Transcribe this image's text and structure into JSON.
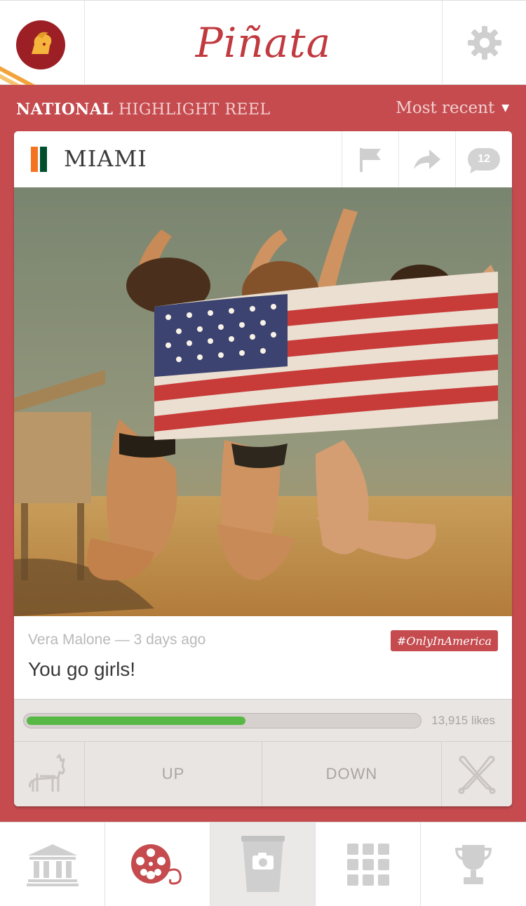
{
  "app": {
    "title": "Piñata",
    "team_logo": "usc-trojan-logo",
    "settings_icon": "gear-icon"
  },
  "reel": {
    "title_bold": "NATIONAL",
    "title_light": "HIGHLIGHT REEL",
    "sort_label": "Most recent",
    "sort_icon": "caret-down-icon"
  },
  "post": {
    "school": "MIAMI",
    "school_colors": [
      "#f47321",
      "#ffffff",
      "#005030"
    ],
    "actions": [
      {
        "icon": "flag-icon"
      },
      {
        "icon": "share-arrow-icon"
      },
      {
        "icon": "comment-bubble-icon",
        "count": "12"
      }
    ],
    "author_line": "Vera Malone — 3 days ago",
    "hashtag": "#OnlyInAmerica",
    "caption": "You go girls!",
    "like_progress": 0.56,
    "likes_label": "13,915 likes",
    "vote": {
      "up_label": "UP",
      "down_label": "DOWN",
      "left_icon": "pinata-donkey-icon",
      "right_icon": "crossed-bats-icon"
    }
  },
  "tabs": [
    {
      "icon": "stadium-columns-icon",
      "active": false
    },
    {
      "icon": "film-reel-icon",
      "active": false
    },
    {
      "icon": "cup-camera-icon",
      "active": true
    },
    {
      "icon": "grid-icon",
      "active": false
    },
    {
      "icon": "trophy-icon",
      "active": false
    }
  ],
  "colors": {
    "brand_red": "#c54b4f",
    "title_red": "#c03a3f",
    "progress_green": "#57b845",
    "icon_gray": "#cfcfcf"
  }
}
